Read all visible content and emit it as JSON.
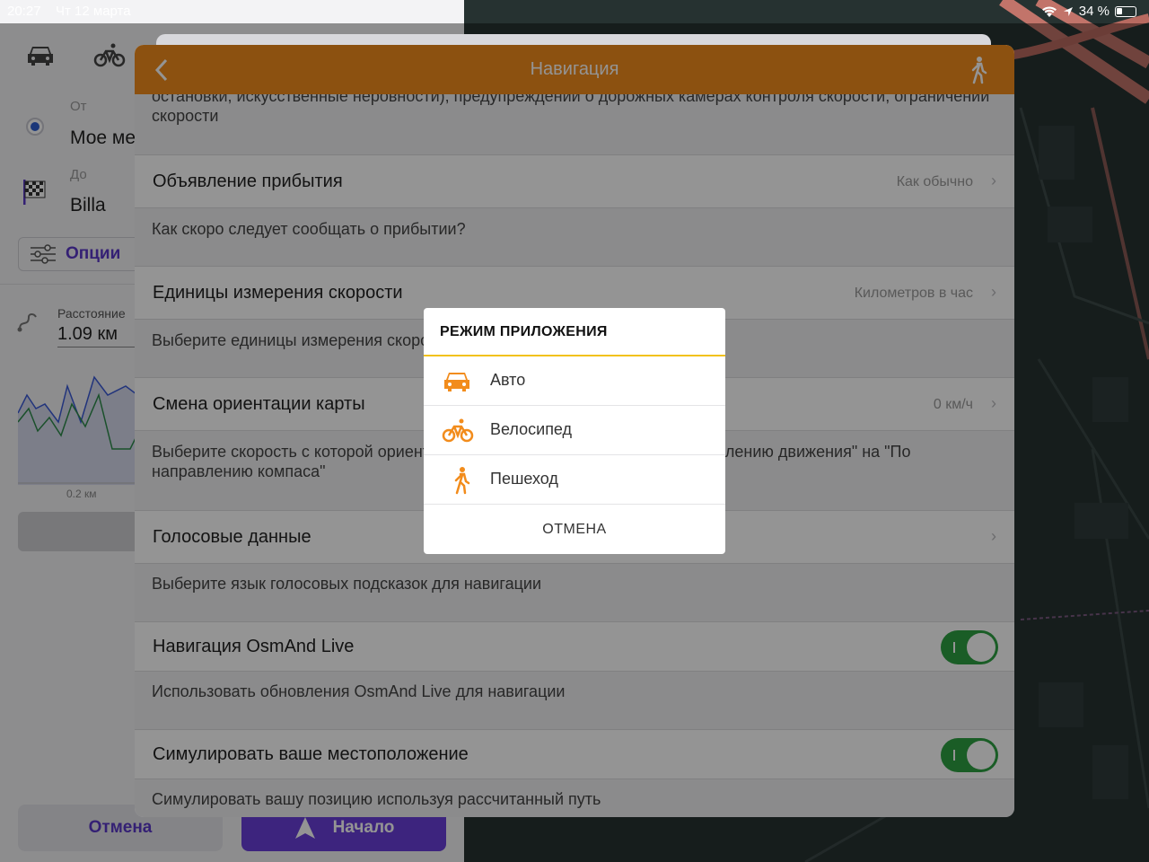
{
  "status_bar": {
    "time": "20:27",
    "date": "Чт 12 марта",
    "battery": "34 %"
  },
  "route_panel": {
    "from_label": "От",
    "from_value": "Мое ме",
    "to_label": "До",
    "to_value": "Billa",
    "options_label": "Опции",
    "distance_label": "Расстояние",
    "distance_value": "1.09 км",
    "scale_label": "0.2 км",
    "cancel_label": "Отмена",
    "start_label": "Начало"
  },
  "sheet": {
    "title": "Навигация",
    "top_desc": "остановки, искусственные неровности), предупреждении о дорожных камерах контроля скорости, ограничений скорости",
    "rows": [
      {
        "title": "Объявление прибытия",
        "value": "Как обычно",
        "desc": "Как скоро следует сообщать о прибытии?"
      },
      {
        "title": "Единицы измерения скорости",
        "value": "Километров в час",
        "desc": "Выберите единицы измерения скорости"
      },
      {
        "title": "Смена ориентации карты",
        "value": "0 км/ч",
        "desc": "Выберите скорость с которой ориентация карты переключится с \"По направлению движения\" на \"По направлению компаса\""
      },
      {
        "title": "Голосовые данные",
        "value": "",
        "desc": "Выберите язык голосовых подсказок для навигации"
      },
      {
        "title": "Навигация OsmAnd Live",
        "desc": "Использовать обновления OsmAnd Live для навигации",
        "toggle": true
      },
      {
        "title": "Симулировать ваше местоположение",
        "desc": "Симулировать вашу позицию используя рассчитанный путь",
        "toggle": true
      }
    ]
  },
  "modal": {
    "title": "РЕЖИМ ПРИЛОЖЕНИЯ",
    "options": [
      {
        "label": "Авто",
        "icon": "car-icon"
      },
      {
        "label": "Велосипед",
        "icon": "bicycle-icon"
      },
      {
        "label": "Пешеход",
        "icon": "pedestrian-icon"
      }
    ],
    "cancel": "ОТМЕНА"
  },
  "colors": {
    "accent": "#f28c1c",
    "brand_purple": "#6a3fd9",
    "toggle_on": "#2ea043",
    "divider_yellow": "#f2c21b"
  }
}
